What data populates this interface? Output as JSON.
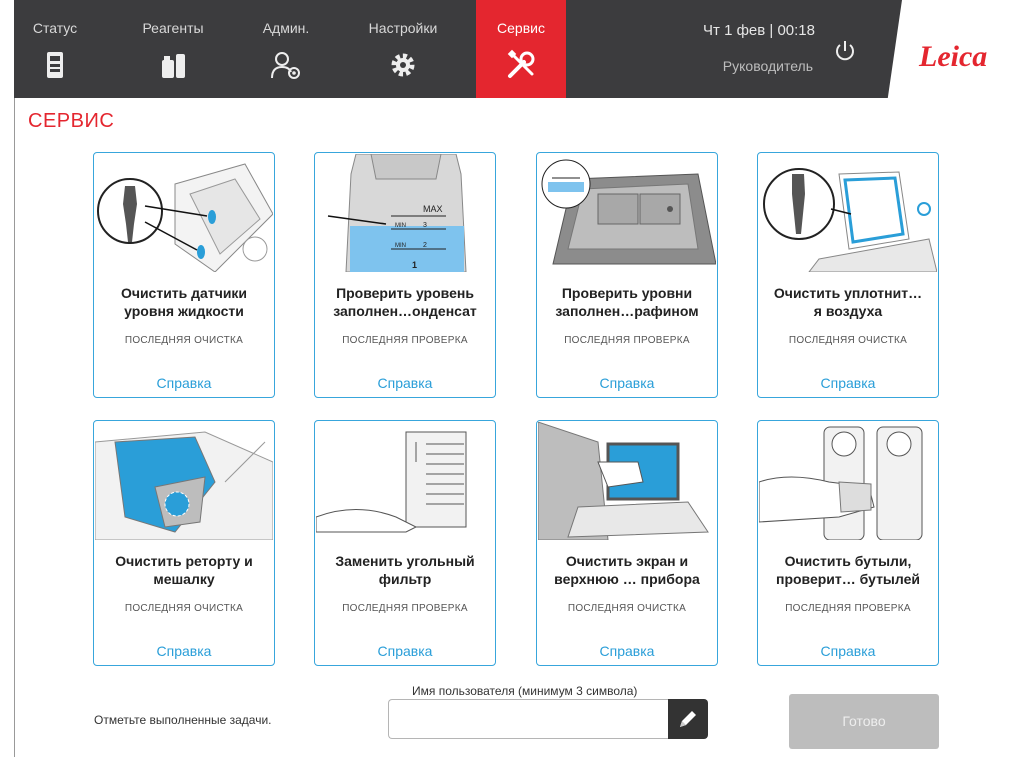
{
  "nav": {
    "tabs": [
      {
        "label": "Статус",
        "icon": "status-icon"
      },
      {
        "label": "Реагенты",
        "icon": "reagents-icon"
      },
      {
        "label": "Админ.",
        "icon": "admin-icon"
      },
      {
        "label": "Настройки",
        "icon": "settings-icon"
      },
      {
        "label": "Сервис",
        "icon": "service-icon",
        "active": true
      }
    ],
    "datetime": "Чт 1 фев | 00:18",
    "role": "Руководитель",
    "logo": "Leica"
  },
  "page_title": "СЕРВИС",
  "cards": [
    {
      "line1": "Очистить датчики",
      "line2": "уровня жидкости",
      "status": "ПОСЛЕДНЯЯ ОЧИСТКА",
      "help": "Справка"
    },
    {
      "line1": "Проверить уровень",
      "line2": "заполнен…онденсат",
      "status": "ПОСЛЕДНЯЯ ПРОВЕРКА",
      "help": "Справка"
    },
    {
      "line1": "Проверить уровни",
      "line2": "заполнен…рафином",
      "status": "ПОСЛЕДНЯЯ ПРОВЕРКА",
      "help": "Справка"
    },
    {
      "line1": "Очистить уплотнит…",
      "line2": "я воздуха",
      "status": "ПОСЛЕДНЯЯ ОЧИСТКА",
      "help": "Справка"
    },
    {
      "line1": "Очистить реторту и",
      "line2": "мешалку",
      "status": "ПОСЛЕДНЯЯ ОЧИСТКА",
      "help": "Справка"
    },
    {
      "line1": "Заменить угольный",
      "line2": "фильтр",
      "status": "ПОСЛЕДНЯЯ ПРОВЕРКА",
      "help": "Справка"
    },
    {
      "line1": "Очистить экран и",
      "line2": "верхнюю … прибора",
      "status": "ПОСЛЕДНЯЯ ОЧИСТКА",
      "help": "Справка"
    },
    {
      "line1": "Очистить бутыли,",
      "line2": "проверит… бутылей",
      "status": "ПОСЛЕДНЯЯ ПРОВЕРКА",
      "help": "Справка"
    }
  ],
  "illustration_text": {
    "max": "MAX",
    "min": "MIN",
    "mid": "3",
    "low": "2",
    "num": "1"
  },
  "footer": {
    "note": "Отметьте выполненные задачи.",
    "user_label": "Имя пользователя (минимум 3 символа)",
    "user_value": "",
    "done": "Готово"
  },
  "colors": {
    "accent": "#e4262f",
    "link": "#2a9ed8",
    "nav_bg": "#3c3c3e",
    "card_border": "#38a6dc",
    "done_disabled": "#bdbdbd"
  }
}
